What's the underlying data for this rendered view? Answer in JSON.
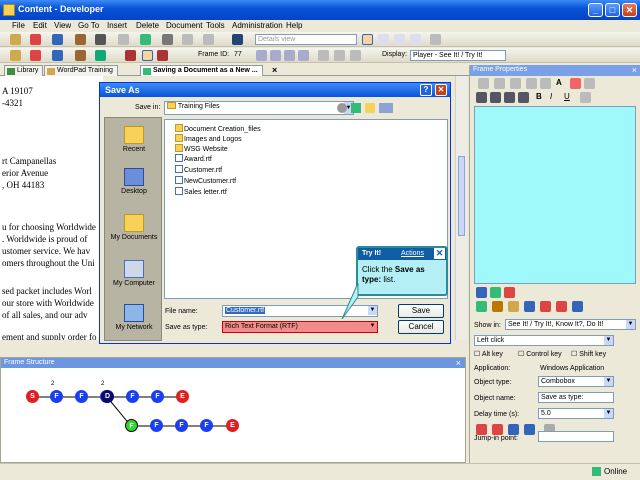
{
  "app": {
    "title": "Content - Developer"
  },
  "menu": [
    "File",
    "Edit",
    "View",
    "Go To",
    "Insert",
    "Delete",
    "Document",
    "Tools",
    "Administration",
    "Help"
  ],
  "toolbar": {
    "frame_label": "Frame ID:",
    "frame_id": "77",
    "views": "Details view",
    "display_label": "Display:",
    "display_value": "Player - See It! / Try It!"
  },
  "tabs": [
    {
      "label": "Library"
    },
    {
      "label": "WordPad Training"
    },
    {
      "label": "Saving a Document as a New ..."
    }
  ],
  "doc_lines": [
    "A 19107",
    "-4321",
    "rt Campanellas",
    "erior Avenue",
    ", OH  44183",
    "u for choosing Worldwide",
    ". Worldwide is proud of",
    "ustomer service. We hav",
    "omers throughout the Uni",
    "sed packet includes Worl",
    "our store with Worldwide",
    "of all sales, and our adv",
    "ement and supply order fo"
  ],
  "dialog": {
    "title": "Save As",
    "save_in_label": "Save in:",
    "save_in_value": "Training Files",
    "places": [
      "Recent",
      "Desktop",
      "My Documents",
      "My Computer",
      "My Network"
    ],
    "files": [
      {
        "name": "Document Creation_files",
        "kind": "folder"
      },
      {
        "name": "Images and Logos",
        "kind": "folder"
      },
      {
        "name": "WSG Website",
        "kind": "folder"
      },
      {
        "name": "Award.rtf",
        "kind": "rtf"
      },
      {
        "name": "Customer.rtf",
        "kind": "rtf"
      },
      {
        "name": "NewCustomer.rtf",
        "kind": "rtf"
      },
      {
        "name": "Sales letter.rtf",
        "kind": "rtf"
      }
    ],
    "file_name_label": "File name:",
    "file_name_value": "Customer.rtf",
    "save_type_label": "Save as type:",
    "save_type_value": "Rich Text Format (RTF)",
    "save_button": "Save",
    "cancel_button": "Cancel"
  },
  "tryit": {
    "title": "Try It!",
    "actions": "Actions",
    "line1": "Click the ",
    "bold1": "Save as",
    "line2": "type:",
    "line3": " list."
  },
  "props": {
    "header": "Frame Properties",
    "show_in_label": "Show in:",
    "show_in_value": "See It! / Try It!, Know It?, Do It!",
    "action": "Left click",
    "alt_key": "Alt key",
    "control_key": "Control key",
    "shift_key": "Shift key",
    "application_label": "Application:",
    "application_value": "Windows Application",
    "object_type_label": "Object type:",
    "object_type_value": "Combobox",
    "object_name_label": "Object name:",
    "object_name_value": "Save as type:",
    "delay_label": "Delay time (s):",
    "delay_value": "5.0",
    "jump_label": "Jump-in point:"
  },
  "frame_structure": {
    "header": "Frame Structure",
    "row1": [
      "S",
      "F",
      "F",
      "F",
      "D",
      "F",
      "F",
      "E"
    ],
    "row1_superscripts": [
      "",
      "2",
      "",
      "2",
      "",
      "",
      "",
      ""
    ],
    "row2": [
      "F",
      "F",
      "F",
      "F",
      "E"
    ]
  },
  "status": {
    "text": "Online"
  },
  "colors": {
    "start": "#e02020",
    "frame": "#1a3ff0",
    "decision": "#0a0a6a",
    "end": "#e02020",
    "alt_frame": "#2bd82b"
  }
}
